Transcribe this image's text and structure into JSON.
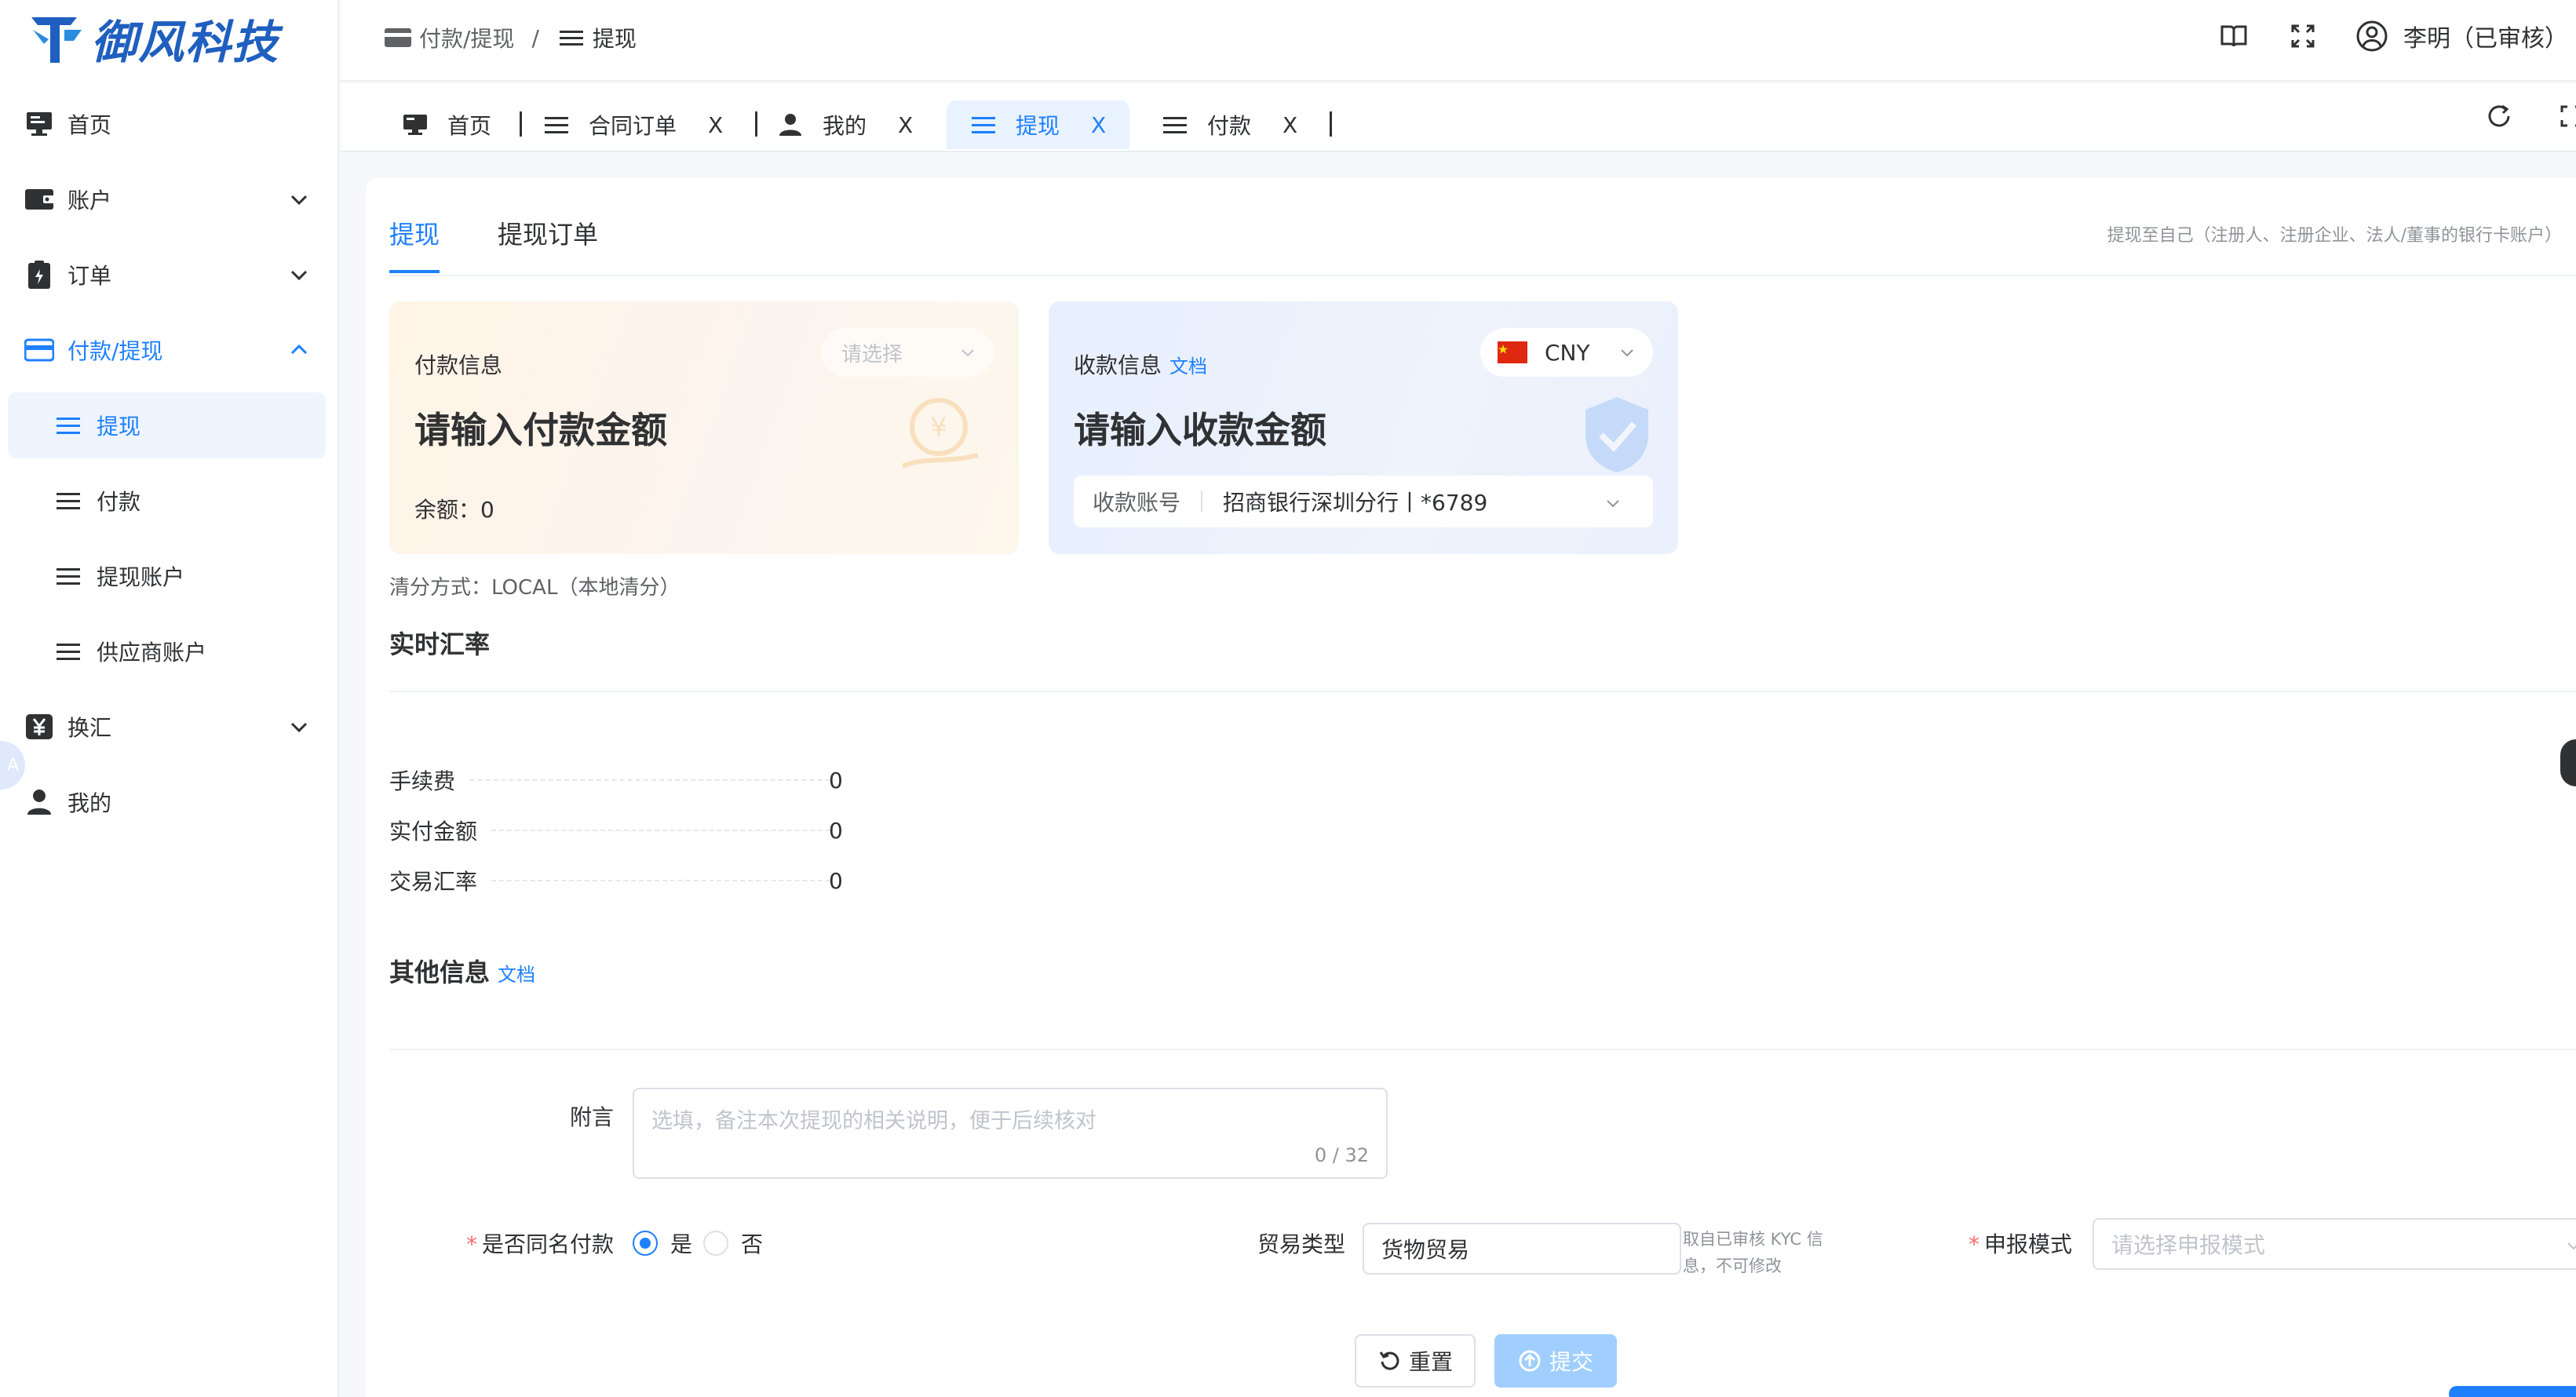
{
  "app": {
    "logo_text": "御风科技",
    "brand_color": "#1f5fbf",
    "accent": "#1e80ff"
  },
  "sidebar": {
    "items": [
      {
        "label": "首页",
        "icon": "monitor-icon"
      },
      {
        "label": "账户",
        "icon": "wallet-icon"
      },
      {
        "label": "订单",
        "icon": "clipboard-icon"
      },
      {
        "label": "付款/提现",
        "icon": "card-icon"
      },
      {
        "label": "换汇",
        "icon": "yen-icon"
      },
      {
        "label": "我的",
        "icon": "user-icon"
      }
    ],
    "sub_items": [
      {
        "label": "提现"
      },
      {
        "label": "付款"
      },
      {
        "label": "提现账户"
      },
      {
        "label": "供应商账户"
      }
    ],
    "float_tag": "A"
  },
  "header": {
    "crumb_parent": "付款/提现",
    "crumb_sep": "/",
    "crumb_current": "提现",
    "user_name": "李明（已审核）"
  },
  "tabs": [
    {
      "label": "首页"
    },
    {
      "label": "合同订单",
      "close": "X"
    },
    {
      "label": "我的",
      "close": "X"
    },
    {
      "label": "提现",
      "close": "X"
    },
    {
      "label": "付款",
      "close": "X"
    }
  ],
  "content": {
    "inner_tabs": [
      "提现",
      "提现订单"
    ],
    "tip": "提现至自己（注册人、注册企业、法人/董事的银行卡账户）",
    "pay_card": {
      "title": "付款信息",
      "placeholder": "请输入付款金额",
      "select_placeholder": "请选择",
      "balance": "余额：0"
    },
    "rec_card": {
      "title": "收款信息",
      "doc": "文档",
      "placeholder": "请输入收款金额",
      "currency": "CNY",
      "account_label": "收款账号",
      "account_value": "招商银行深圳分行丨*6789"
    },
    "clear_way": "清分方式：LOCAL（本地清分）",
    "rate_title": "实时汇率",
    "fees": [
      {
        "key": "手续费",
        "value": "0"
      },
      {
        "key": "实付金额",
        "value": "0"
      },
      {
        "key": "交易汇率",
        "value": "0"
      }
    ],
    "other_title": "其他信息",
    "other_doc": "文档",
    "note_label": "附言",
    "note_placeholder": "选填，备注本次提现的相关说明，便于后续核对",
    "note_count": "0 / 32",
    "same_name_label": "是否同名付款",
    "radio_yes": "是",
    "radio_no": "否",
    "trade_type_label": "贸易类型",
    "trade_type_value": "货物贸易",
    "trade_hint": "取自已审核 KYC 信息，不可修改",
    "declare_label": "申报模式",
    "declare_placeholder": "请选择申报模式",
    "reset_label": "重置",
    "submit_label": "提交"
  }
}
